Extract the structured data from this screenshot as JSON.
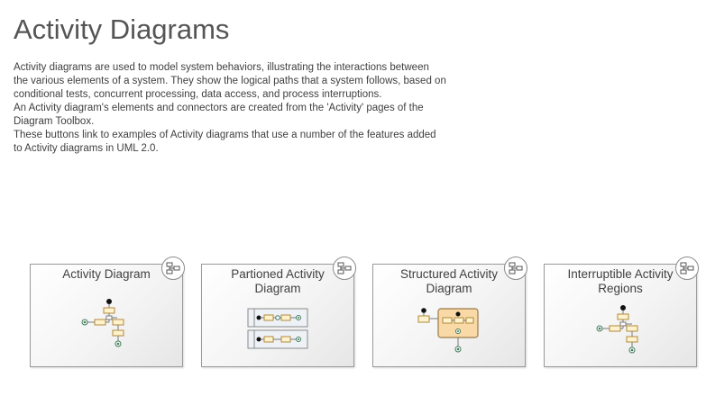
{
  "header": {
    "title": "Activity Diagrams"
  },
  "intro": {
    "paragraphs": [
      "Activity diagrams are used to model system behaviors, illustrating the interactions between the various elements of a system. They show the logical paths that a system follows, based on conditional tests, concurrent processing, data access, and process interruptions.",
      "An Activity diagram's elements and connectors are created from the 'Activity' pages of the Diagram Toolbox.",
      "These buttons link to examples of Activity diagrams that use a number of the features added to Activity diagrams in UML 2.0."
    ]
  },
  "cards": [
    {
      "title": "Activity Diagram",
      "icon": "diagram-link-icon"
    },
    {
      "title": "Partioned Activity Diagram",
      "icon": "diagram-link-icon"
    },
    {
      "title": "Structured Activity Diagram",
      "icon": "diagram-link-icon"
    },
    {
      "title": "Interruptible Activity Regions",
      "icon": "diagram-link-icon"
    }
  ],
  "colors": {
    "action_fill": "#fff2cc",
    "action_stroke": "#b08a3c",
    "structured_fill": "#f9d9a6"
  }
}
